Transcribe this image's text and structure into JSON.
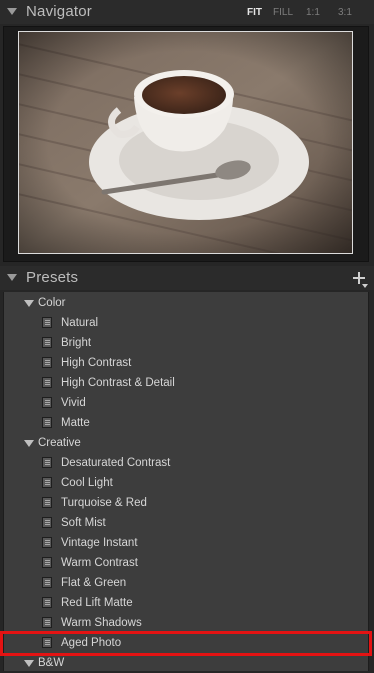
{
  "navigator": {
    "title": "Navigator",
    "zoom_options": [
      {
        "label": "FIT",
        "active": true
      },
      {
        "label": "FILL",
        "active": false
      },
      {
        "label": "1:1",
        "active": false
      },
      {
        "label": "3:1",
        "active": false
      }
    ],
    "preview_icon": "coffee-cup-photo"
  },
  "presets": {
    "title": "Presets",
    "add_icon": "plus-icon",
    "groups": [
      {
        "name": "Color",
        "items": [
          "Natural",
          "Bright",
          "High Contrast",
          "High Contrast & Detail",
          "Vivid",
          "Matte"
        ]
      },
      {
        "name": "Creative",
        "items": [
          "Desaturated Contrast",
          "Cool Light",
          "Turquoise & Red",
          "Soft Mist",
          "Vintage Instant",
          "Warm Contrast",
          "Flat & Green",
          "Red Lift Matte",
          "Warm Shadows",
          "Aged Photo"
        ]
      },
      {
        "name": "B&W",
        "items": []
      }
    ],
    "highlighted_item": "Aged Photo",
    "highlight_color": "#e41313"
  }
}
